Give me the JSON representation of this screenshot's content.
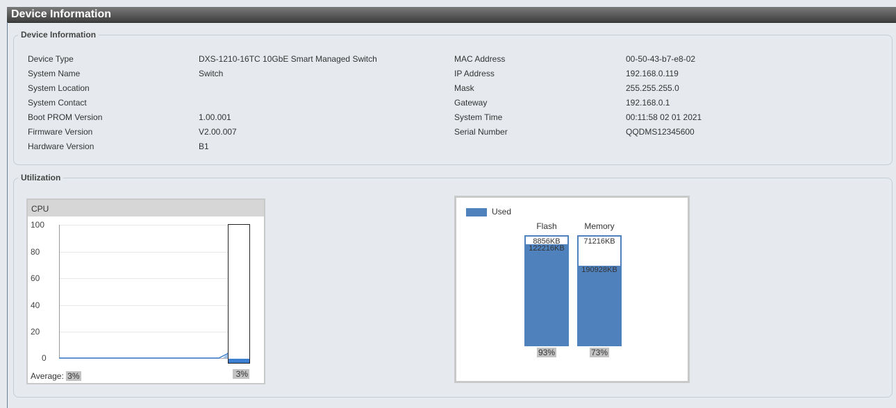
{
  "page_title": "Device Information",
  "device_info": {
    "legend": "Device Information",
    "left": [
      {
        "label": "Device Type",
        "value": "DXS-1210-16TC 10GbE Smart Managed Switch"
      },
      {
        "label": "System Name",
        "value": "Switch"
      },
      {
        "label": "System Location",
        "value": ""
      },
      {
        "label": "System Contact",
        "value": ""
      },
      {
        "label": "Boot PROM Version",
        "value": "1.00.001"
      },
      {
        "label": "Firmware Version",
        "value": "V2.00.007"
      },
      {
        "label": "Hardware Version",
        "value": "B1"
      }
    ],
    "right": [
      {
        "label": "MAC Address",
        "value": "00-50-43-b7-e8-02"
      },
      {
        "label": "IP Address",
        "value": "192.168.0.119"
      },
      {
        "label": "Mask",
        "value": "255.255.255.0"
      },
      {
        "label": "Gateway",
        "value": "192.168.0.1"
      },
      {
        "label": "System Time",
        "value": "00:11:58 02 01 2021"
      },
      {
        "label": "Serial Number",
        "value": "QQDMS12345600"
      }
    ]
  },
  "utilization": {
    "legend": "Utilization",
    "cpu": {
      "title": "CPU",
      "y_ticks": [
        "100",
        "80",
        "60",
        "40",
        "20",
        "0"
      ],
      "average_label": "Average:",
      "average_value": "3%",
      "current_value": "3%",
      "current_fraction": 0.03,
      "line_color": "#3d7fd0"
    },
    "memory_chart": {
      "legend_label": "Used",
      "used_color": "#4f81bd",
      "bars": [
        {
          "name": "Flash",
          "free": "8856KB",
          "used": "122216KB",
          "percent": "93%",
          "fraction": 0.93
        },
        {
          "name": "Memory",
          "free": "71216KB",
          "used": "190928KB",
          "percent": "73%",
          "fraction": 0.73
        }
      ]
    }
  }
}
